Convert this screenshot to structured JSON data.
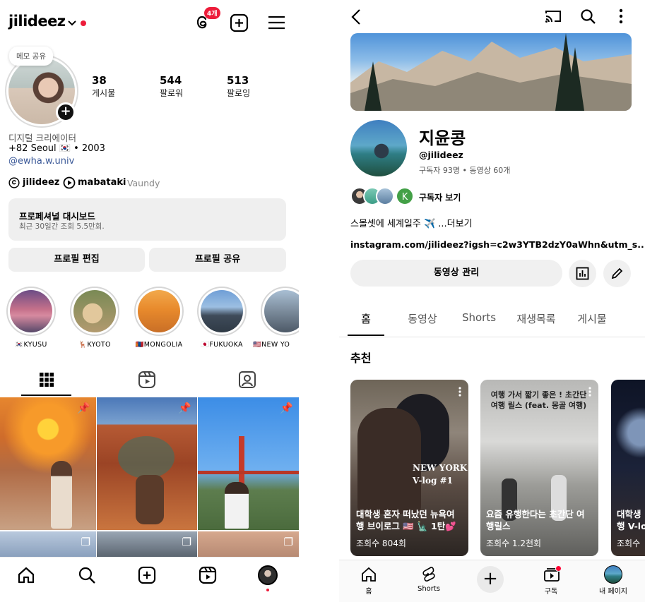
{
  "instagram": {
    "username": "jilideez",
    "threads_badge": "4개",
    "note_bubble": "메모 공유",
    "stats": [
      {
        "value": "38",
        "label": "게시물"
      },
      {
        "value": "544",
        "label": "팔로워"
      },
      {
        "value": "513",
        "label": "팔로잉"
      }
    ],
    "bio": {
      "category": "디지털 크리에이터",
      "line2": "+82 Seoul 🇰🇷 • 2003",
      "mention": "@ewha.w.univ",
      "threads_handle": "jilideez",
      "music_title": "mabataki",
      "music_artist": "· Vaundy"
    },
    "dashboard": {
      "title": "프로페셔널 대시보드",
      "subtitle": "최근 30일간 조회 5.5만회."
    },
    "buttons": {
      "edit": "프로필 편집",
      "share": "프로필 공유"
    },
    "highlights": [
      {
        "label": "🇰🇷KYUSU"
      },
      {
        "label": "🦌KYOTO"
      },
      {
        "label": "🇲🇳MONGOLIA"
      },
      {
        "label": "🇯🇵FUKUOKA"
      },
      {
        "label": "🇺🇸NEW YO"
      }
    ]
  },
  "youtube": {
    "channel_name": "지윤콩",
    "handle": "@jilideez",
    "meta": "구독자 93명 • 동영상 60개",
    "subscribers_link": "구독자 보기",
    "avatar_letter": "K",
    "description": "스몰셋에 세계일주 ✈️ ...더보기",
    "link": "instagram.com/jilideez?igsh=c2w3YTB2dzY0aWhn&utm_s...",
    "manage_button": "동영상 관리",
    "tabs": [
      "홈",
      "동영상",
      "Shorts",
      "재생목록",
      "게시물"
    ],
    "section_title": "추천",
    "cards": [
      {
        "overlay": "NEW YORK\nV-log #1",
        "title": "대학생 혼자 떠났던 뉴욕여행 브이로그 🇺🇸 🗽 1탄💕",
        "views": "조회수 804회"
      },
      {
        "overlay": "여행 가서 짧기 좋은 ! 초간단 여행 릴스 (feat. 몽골 여행)",
        "title": "요즘 유행한다는 초간단 여행릴스",
        "views": "조회수 1.2천회"
      },
      {
        "title": "대학생 행 V-lo",
        "views": "조회수"
      }
    ],
    "bottom_nav": [
      "홈",
      "Shorts",
      "",
      "구독",
      "내 페이지"
    ]
  },
  "colors": {
    "ig_link": "#3b5998",
    "yt_red": "#ff0033",
    "notif_red": "#ed1c3a"
  }
}
